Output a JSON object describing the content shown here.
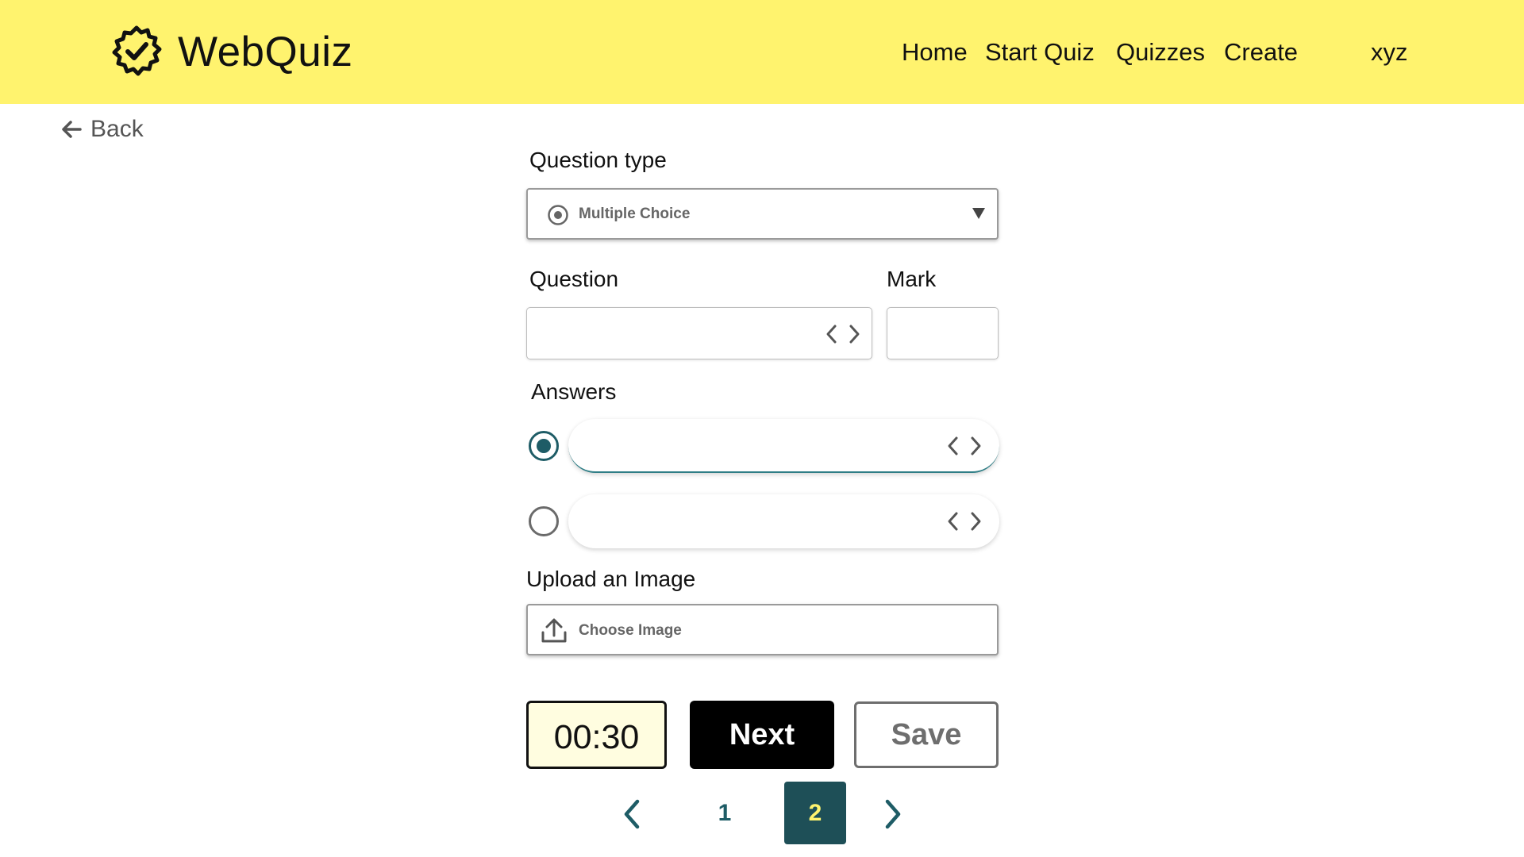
{
  "header": {
    "app_name": "WebQuiz",
    "nav": [
      "Home",
      "Start Quiz",
      "Quizzes",
      "Create"
    ],
    "user": "xyz",
    "brand_icon": "gear-check-icon",
    "background": "#fff36e"
  },
  "back": {
    "label": "Back",
    "icon": "arrow-left-icon"
  },
  "form": {
    "question_type_label": "Question type",
    "question_type_value": "Multiple Choice",
    "question_label": "Question",
    "question_value": "",
    "mark_label": "Mark",
    "mark_value": "",
    "answers_label": "Answers",
    "answers": [
      {
        "value": "",
        "selected": true
      },
      {
        "value": "",
        "selected": false
      }
    ],
    "upload_label": "Upload an Image",
    "upload_button": "Choose Image"
  },
  "actions": {
    "timer": "00:30",
    "next": "Next",
    "save": "Save"
  },
  "pagination": {
    "pages": [
      "1",
      "2"
    ],
    "current": "2"
  },
  "colors": {
    "accent": "#1e5c66",
    "header": "#fff36e",
    "timer_bg": "#fffde0"
  }
}
